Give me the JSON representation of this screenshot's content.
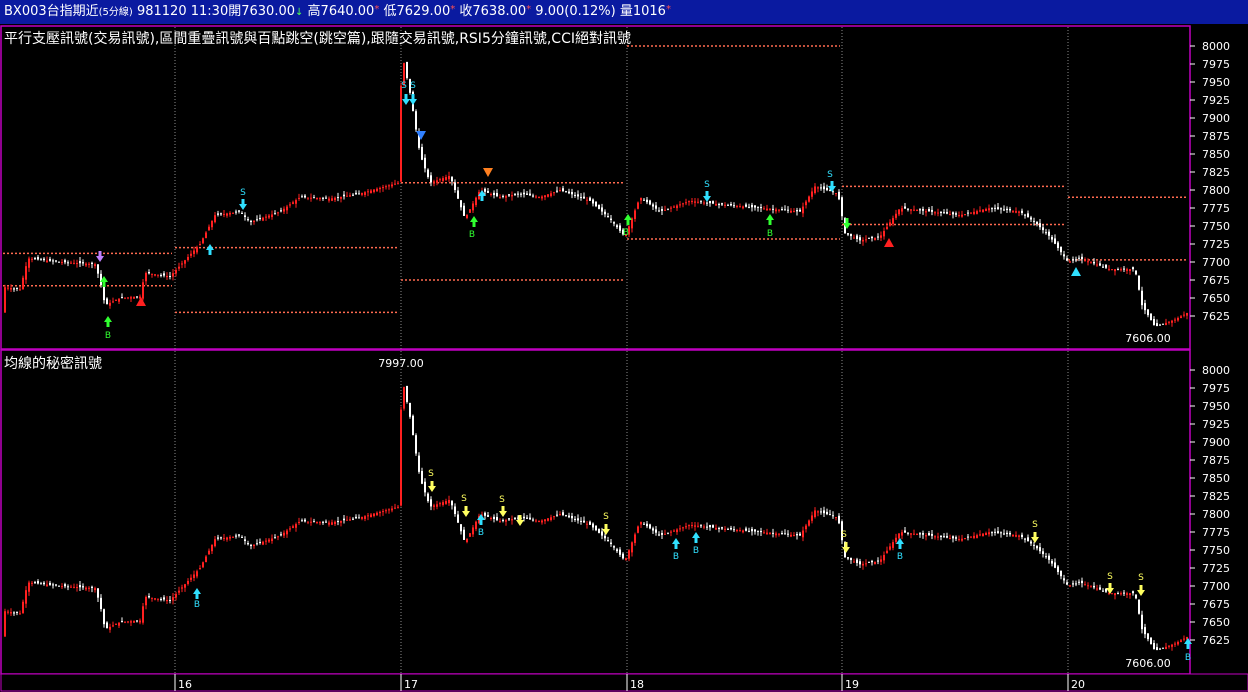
{
  "titlebar": {
    "symbol": "BX003",
    "name": "台指期近",
    "period": "(5分線)",
    "date": "981120",
    "time": "11:30",
    "open_label": "開",
    "open": "7630.00",
    "high_label": "高",
    "high": "7640.00",
    "low_label": "低",
    "low": "7629.00",
    "close_label": "收",
    "close": "7638.00",
    "change": "9.00(0.12%)",
    "volume_label": "量",
    "volume": "1016"
  },
  "top_panel": {
    "title": "平行支壓訊號(交易訊號),區間重疊訊號與百點跳空(跳空篇),跟隨交易訊號,RSI5分鐘訊號,CCI絕對訊號",
    "y_ticks": [
      "8000",
      "7975",
      "7950",
      "7925",
      "7900",
      "7875",
      "7850",
      "7825",
      "7800",
      "7775",
      "7750",
      "7725",
      "7700",
      "7675",
      "7650",
      "7625"
    ],
    "last_value_label": "7606.00",
    "signal_b": "B",
    "signal_s": "S"
  },
  "bottom_panel": {
    "title": "均線的秘密訊號",
    "y_ticks": [
      "8000",
      "7975",
      "7950",
      "7925",
      "7900",
      "7875",
      "7850",
      "7825",
      "7800",
      "7775",
      "7750",
      "7725",
      "7700",
      "7675",
      "7650",
      "7625"
    ],
    "peak_label": "7997.00",
    "last_value_label": "7606.00"
  },
  "x_axis": {
    "day_labels": [
      "16",
      "17",
      "18",
      "19",
      "20"
    ]
  },
  "colors": {
    "titlebar_bg": "#0a1aa0",
    "panel_border": "#c000c0",
    "grid": "#8a8a8a",
    "up_candle": "#ff2020",
    "down_candle": "#ffffff",
    "dotted_line": "#ff6a50",
    "signal_cyan": "#30e0ff",
    "signal_green": "#30ff30",
    "signal_red": "#ff2020",
    "signal_yellow": "#ffff60",
    "signal_blue": "#3080ff",
    "signal_orange": "#ff8020",
    "signal_purple": "#c080ff"
  }
}
